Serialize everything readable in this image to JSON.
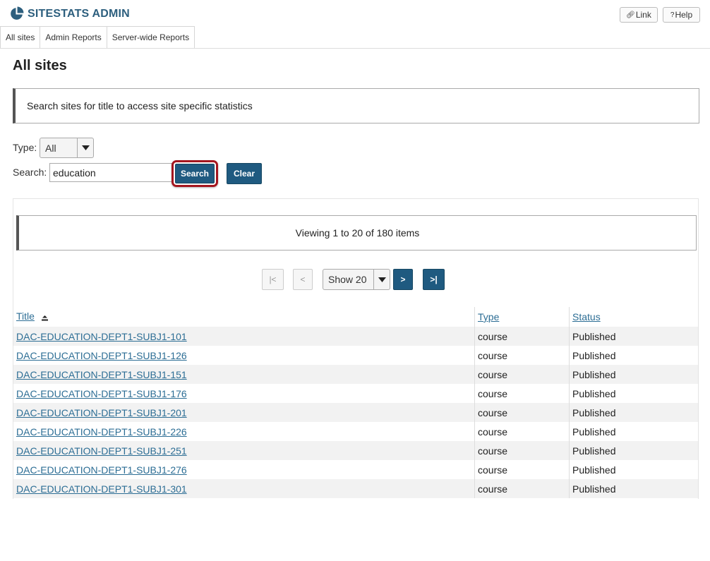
{
  "header": {
    "brand": "SITESTATS ADMIN",
    "link_label": "Link",
    "help_label": "Help",
    "link_icon": "link-icon",
    "help_icon": "question-icon"
  },
  "tabs": [
    {
      "label": "All sites"
    },
    {
      "label": "Admin Reports"
    },
    {
      "label": "Server-wide Reports"
    }
  ],
  "page": {
    "title": "All sites",
    "info": "Search sites for title to access site specific statistics"
  },
  "filters": {
    "type_label": "Type:",
    "type_value": "All",
    "search_label": "Search:",
    "search_value": "education",
    "search_button": "Search",
    "clear_button": "Clear"
  },
  "results": {
    "viewing": "Viewing 1 to 20 of 180 items",
    "pager": {
      "first": "|<",
      "prev": "<",
      "show": "Show 20",
      "next": ">",
      "last": ">|"
    },
    "columns": {
      "title": "Title",
      "type": "Type",
      "status": "Status"
    },
    "rows": [
      {
        "title": "DAC-EDUCATION-DEPT1-SUBJ1-101",
        "type": "course",
        "status": "Published"
      },
      {
        "title": "DAC-EDUCATION-DEPT1-SUBJ1-126",
        "type": "course",
        "status": "Published"
      },
      {
        "title": "DAC-EDUCATION-DEPT1-SUBJ1-151",
        "type": "course",
        "status": "Published"
      },
      {
        "title": "DAC-EDUCATION-DEPT1-SUBJ1-176",
        "type": "course",
        "status": "Published"
      },
      {
        "title": "DAC-EDUCATION-DEPT1-SUBJ1-201",
        "type": "course",
        "status": "Published"
      },
      {
        "title": "DAC-EDUCATION-DEPT1-SUBJ1-226",
        "type": "course",
        "status": "Published"
      },
      {
        "title": "DAC-EDUCATION-DEPT1-SUBJ1-251",
        "type": "course",
        "status": "Published"
      },
      {
        "title": "DAC-EDUCATION-DEPT1-SUBJ1-276",
        "type": "course",
        "status": "Published"
      },
      {
        "title": "DAC-EDUCATION-DEPT1-SUBJ1-301",
        "type": "course",
        "status": "Published"
      }
    ]
  },
  "colors": {
    "brand": "#2d5f7e",
    "primary_button": "#1f5a80",
    "highlight_ring": "#a3161f",
    "link": "#2d6e95"
  }
}
